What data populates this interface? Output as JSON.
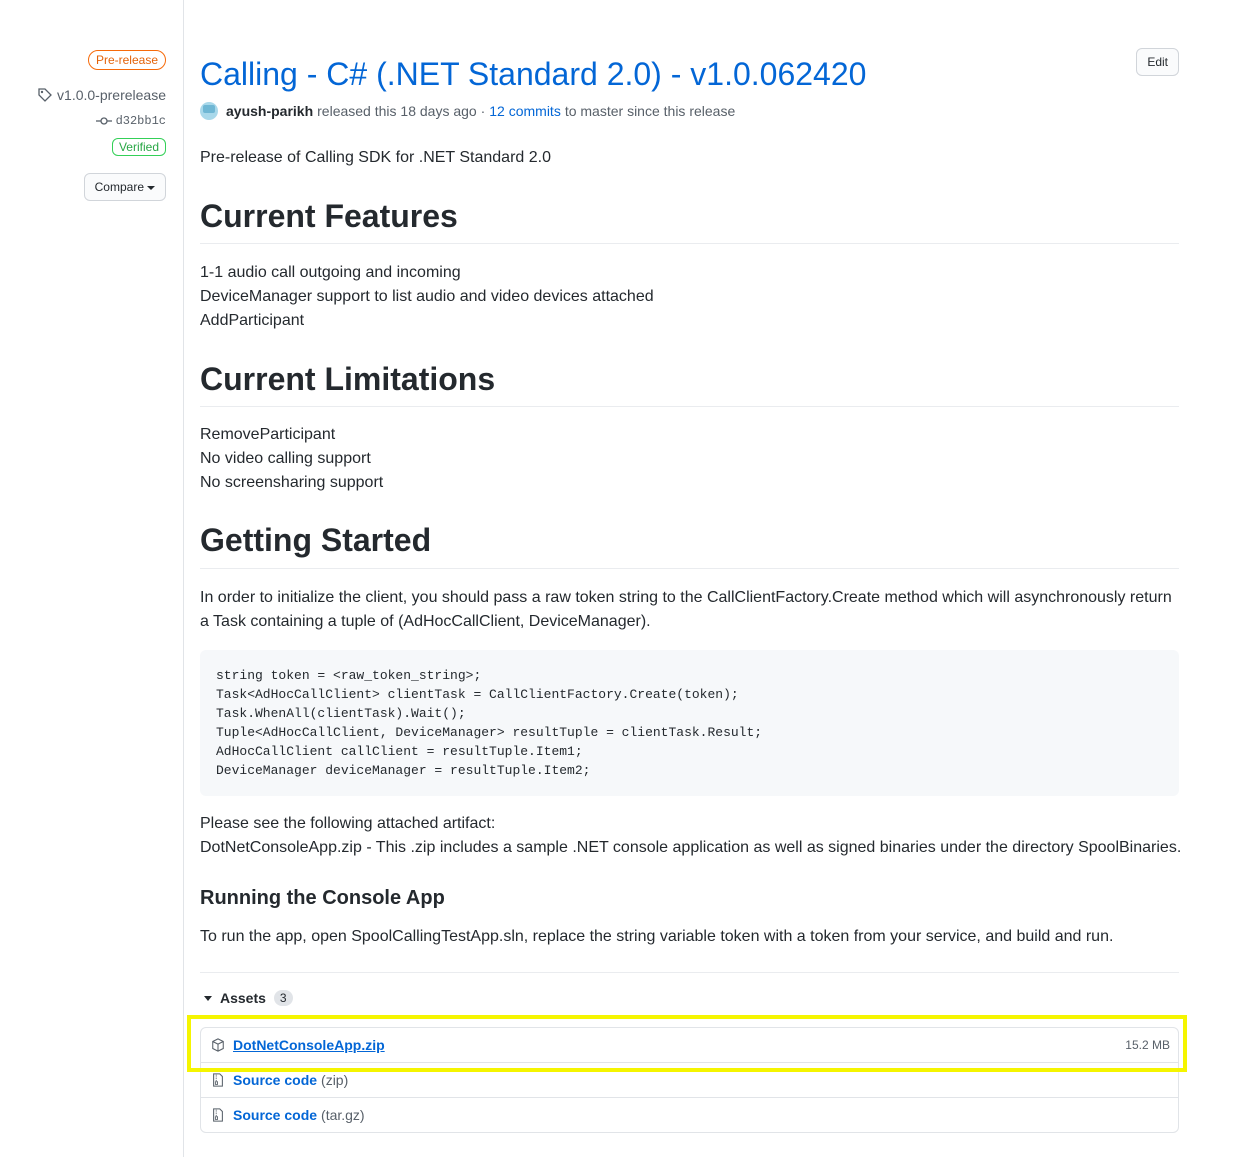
{
  "sidebar": {
    "prerelease_badge": "Pre-release",
    "tag": "v1.0.0-prerelease",
    "commit": "d32bb1c",
    "verified": "Verified",
    "compare": "Compare"
  },
  "release": {
    "title": "Calling - C# (.NET Standard 2.0) - v1.0.062420",
    "edit": "Edit",
    "author": "ayush-parikh",
    "released": "released this 18 days ago ·",
    "commits_link": "12 commits",
    "commits_suffix": "to master since this release"
  },
  "body": {
    "intro": "Pre-release of Calling SDK for .NET Standard 2.0",
    "features_heading": "Current Features",
    "features": [
      "1-1 audio call outgoing and incoming",
      "DeviceManager support to list audio and video devices attached",
      "AddParticipant"
    ],
    "limitations_heading": "Current Limitations",
    "limitations": [
      "RemoveParticipant",
      "No video calling support",
      "No screensharing support"
    ],
    "getting_started_heading": "Getting Started",
    "gs_line1": "In order to initialize the client, you should pass a raw token string to the CallClientFactory.Create method which will asynchronously return",
    "gs_line2": "a Task containing a tuple of (AdHocCallClient, DeviceManager).",
    "code": [
      "string token = <raw_token_string>;",
      "Task<AdHocCallClient> clientTask = CallClientFactory.Create(token);",
      "Task.WhenAll(clientTask).Wait();",
      "Tuple<AdHocCallClient, DeviceManager> resultTuple = clientTask.Result;",
      "AdHocCallClient callClient = resultTuple.Item1;",
      "DeviceManager deviceManager = resultTuple.Item2;"
    ],
    "artifact_line1": "Please see the following attached artifact:",
    "artifact_line2": "DotNetConsoleApp.zip - This .zip includes a sample .NET console application as well as signed binaries under the directory SpoolBinaries.",
    "console_heading": "Running the Console App",
    "console_text": "To run the app, open SpoolCallingTestApp.sln, replace the string variable token with a token from your service, and build and run."
  },
  "assets": {
    "label": "Assets",
    "count": "3",
    "items": [
      {
        "name": "DotNetConsoleApp.zip",
        "ext": "",
        "size": "15.2 MB",
        "icon": "package-icon"
      },
      {
        "name": "Source code",
        "ext": "(zip)",
        "size": "",
        "icon": "file-zip-icon"
      },
      {
        "name": "Source code",
        "ext": "(tar.gz)",
        "size": "",
        "icon": "file-zip-icon"
      }
    ]
  },
  "colors": {
    "link": "#0366d6",
    "highlight": "#f5f500",
    "prerelease": "#e36209",
    "verified": "#28a745"
  }
}
